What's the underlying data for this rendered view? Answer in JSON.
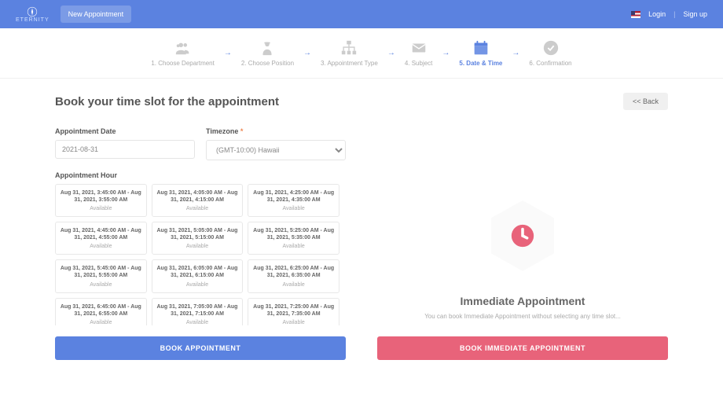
{
  "header": {
    "brand": "ETERNITY",
    "new_appointment": "New Appointment",
    "login": "Login",
    "signup": "Sign up"
  },
  "steps": [
    {
      "label": "1. Choose Department"
    },
    {
      "label": "2. Choose Position"
    },
    {
      "label": "3. Appointment Type"
    },
    {
      "label": "4. Subject"
    },
    {
      "label": "5. Date & Time"
    },
    {
      "label": "6. Confirmation"
    }
  ],
  "page": {
    "heading": "Book your time slot for the appointment",
    "back": "<< Back"
  },
  "form": {
    "date_label": "Appointment Date",
    "date_value": "2021-08-31",
    "timezone_label": "Timezone",
    "timezone_value": "(GMT-10:00) Hawaii",
    "hour_label": "Appointment Hour"
  },
  "slots": [
    {
      "time": "Aug 31, 2021, 3:45:00 AM - Aug 31, 2021, 3:55:00 AM",
      "status": "Available"
    },
    {
      "time": "Aug 31, 2021, 4:05:00 AM - Aug 31, 2021, 4:15:00 AM",
      "status": "Available"
    },
    {
      "time": "Aug 31, 2021, 4:25:00 AM - Aug 31, 2021, 4:35:00 AM",
      "status": "Available"
    },
    {
      "time": "Aug 31, 2021, 4:45:00 AM - Aug 31, 2021, 4:55:00 AM",
      "status": "Available"
    },
    {
      "time": "Aug 31, 2021, 5:05:00 AM - Aug 31, 2021, 5:15:00 AM",
      "status": "Available"
    },
    {
      "time": "Aug 31, 2021, 5:25:00 AM - Aug 31, 2021, 5:35:00 AM",
      "status": "Available"
    },
    {
      "time": "Aug 31, 2021, 5:45:00 AM - Aug 31, 2021, 5:55:00 AM",
      "status": "Available"
    },
    {
      "time": "Aug 31, 2021, 6:05:00 AM - Aug 31, 2021, 6:15:00 AM",
      "status": "Available"
    },
    {
      "time": "Aug 31, 2021, 6:25:00 AM - Aug 31, 2021, 6:35:00 AM",
      "status": "Available"
    },
    {
      "time": "Aug 31, 2021, 6:45:00 AM - Aug 31, 2021, 6:55:00 AM",
      "status": "Available"
    },
    {
      "time": "Aug 31, 2021, 7:05:00 AM - Aug 31, 2021, 7:15:00 AM",
      "status": "Available"
    },
    {
      "time": "Aug 31, 2021, 7:25:00 AM - Aug 31, 2021, 7:35:00 AM",
      "status": "Available"
    }
  ],
  "buttons": {
    "book": "BOOK APPOINTMENT",
    "immediate": "BOOK IMMEDIATE APPOINTMENT"
  },
  "immediate": {
    "title": "Immediate Appointment",
    "subtitle": "You can book Immediate Appointment without selecting any time slot..."
  }
}
